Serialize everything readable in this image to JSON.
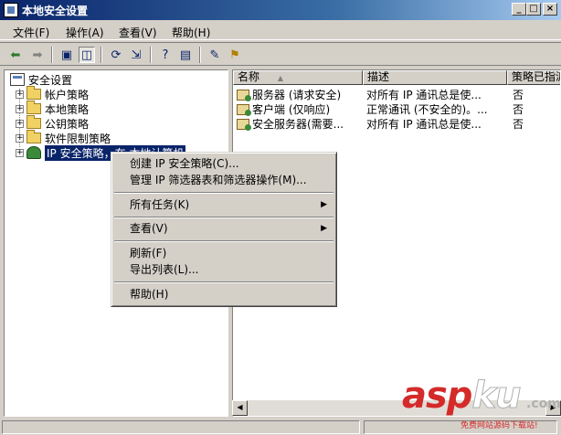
{
  "window": {
    "title": "本地安全设置",
    "controls": [
      "_",
      "□",
      "×"
    ]
  },
  "menubar": [
    "文件(F)",
    "操作(A)",
    "查看(V)",
    "帮助(H)"
  ],
  "toolbar": {
    "icons": [
      "back-arrow-icon",
      "forward-arrow-icon",
      "up-folder-icon",
      "show-tree-icon",
      "refresh-icon",
      "export-icon",
      "help-icon",
      "properties-icon",
      "new-policy-icon",
      "assign-icon"
    ]
  },
  "tree": {
    "root": "安全设置",
    "items": [
      {
        "label": "帐户策略"
      },
      {
        "label": "本地策略"
      },
      {
        "label": "公钥策略"
      },
      {
        "label": "软件限制策略"
      },
      {
        "label": "IP 安全策略，在 本地计算机"
      }
    ]
  },
  "list": {
    "columns": [
      "名称",
      "描述",
      "策略已指派"
    ],
    "sort_indicator": "▲",
    "rows": [
      {
        "name": "服务器 (请求安全)",
        "desc": "对所有 IP 通讯总是使...",
        "assigned": "否"
      },
      {
        "name": "客户端 (仅响应)",
        "desc": "正常通讯 (不安全的)。...",
        "assigned": "否"
      },
      {
        "name": "安全服务器(需要...",
        "desc": "对所有 IP 通讯总是使...",
        "assigned": "否"
      }
    ]
  },
  "context_menu": {
    "items": [
      {
        "label": "创建 IP 安全策略(C)..."
      },
      {
        "label": "管理 IP 筛选器表和筛选器操作(M)..."
      },
      {
        "label": "所有任务(K)",
        "submenu": true
      },
      {
        "label": "查看(V)",
        "submenu": true
      },
      {
        "label": "刷新(F)"
      },
      {
        "label": "导出列表(L)..."
      },
      {
        "label": "帮助(H)"
      }
    ]
  },
  "watermark": {
    "part1": "asp",
    "part2": "ku",
    "suffix": ".com",
    "sub": "免费网站源码下载站!"
  }
}
